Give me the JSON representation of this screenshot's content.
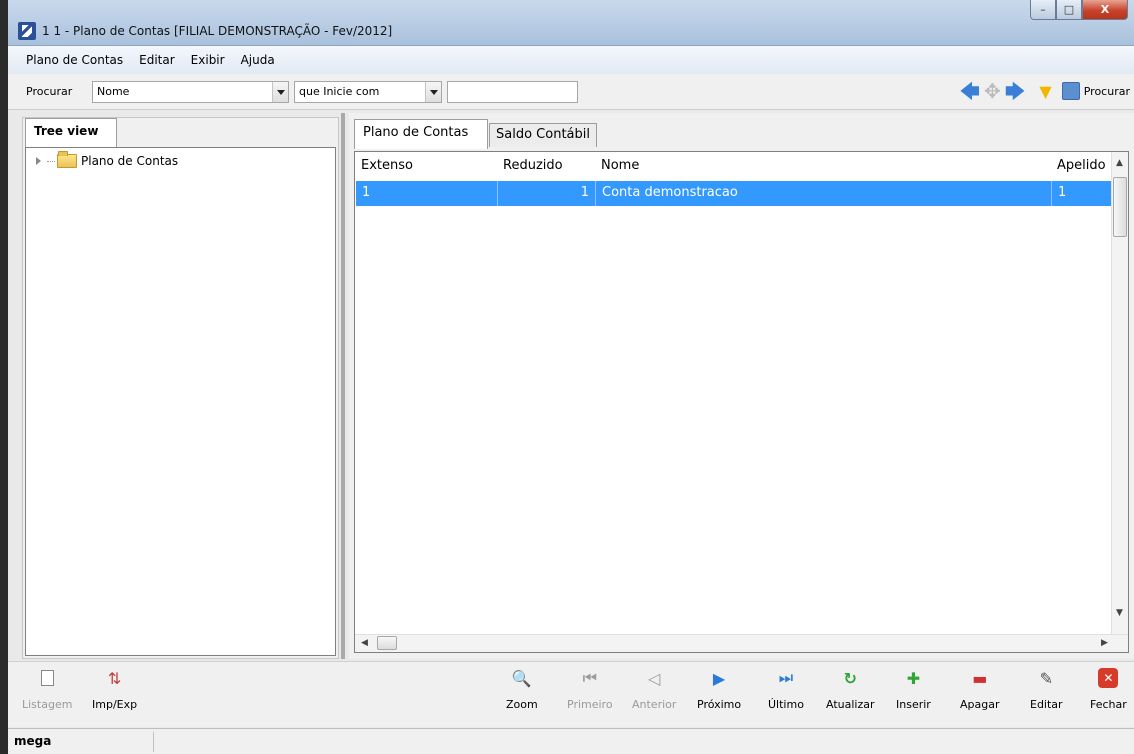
{
  "window": {
    "title": "1 1 -  Plano de Contas [FILIAL DEMONSTRAÇÃO - Fev/2012]",
    "min": "–",
    "max": "□",
    "close": "X"
  },
  "menu": {
    "items": [
      "Plano de Contas",
      "Editar",
      "Exibir",
      "Ajuda"
    ]
  },
  "search": {
    "label": "Procurar",
    "field_value": "Nome",
    "mode_label": "que Inicie com",
    "text_value": "",
    "procurar_label": "Procurar"
  },
  "tree": {
    "tab_label": "Tree view",
    "root_label": "Plano de Contas"
  },
  "tabs": [
    "Plano de Contas",
    "Saldo Contábil"
  ],
  "grid": {
    "columns": [
      "Extenso",
      "Reduzido",
      "Nome",
      "Apelido"
    ],
    "rows": [
      {
        "extenso": "1",
        "reduzido": "1",
        "nome": "Conta demonstracao",
        "apelido": "1"
      }
    ]
  },
  "toolbar": {
    "listagem": "Listagem",
    "impexp": "Imp/Exp",
    "zoom": "Zoom",
    "primeiro": "Primeiro",
    "anterior": "Anterior",
    "proximo": "Próximo",
    "ultimo": "Último",
    "atualizar": "Atualizar",
    "inserir": "Inserir",
    "apagar": "Apagar",
    "editar": "Editar",
    "fechar": "Fechar"
  },
  "status": {
    "user": "mega"
  },
  "colors": {
    "selection": "#3399ff",
    "accent": "#3a7fd6",
    "close": "#c7442b"
  }
}
